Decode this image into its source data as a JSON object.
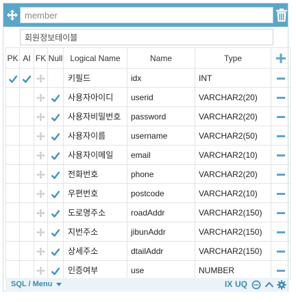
{
  "table_editor": {
    "table_name": "member",
    "table_comment": "회원정보테이블",
    "headers": {
      "pk": "PK",
      "ai": "AI",
      "fk": "FK",
      "null": "Null",
      "logical": "Logical Name",
      "name": "Name",
      "type": "Type"
    },
    "columns": [
      {
        "logical": "키필드",
        "name": "idx",
        "type": "INT",
        "pk": true,
        "ai": true,
        "null": false
      },
      {
        "logical": "사용자아이디",
        "name": "userid",
        "type": "VARCHAR2(20)",
        "pk": false,
        "ai": false,
        "null": true
      },
      {
        "logical": "사용자비밀번호",
        "name": "password",
        "type": "VARCHAR2(20)",
        "pk": false,
        "ai": false,
        "null": true
      },
      {
        "logical": "사용자이름",
        "name": "username",
        "type": "VARCHAR2(50)",
        "pk": false,
        "ai": false,
        "null": true
      },
      {
        "logical": "사용자이메일",
        "name": "email",
        "type": "VARCHAR2(10)",
        "pk": false,
        "ai": false,
        "null": true
      },
      {
        "logical": "전화번호",
        "name": "phone",
        "type": "VARCHAR2(20)",
        "pk": false,
        "ai": false,
        "null": true
      },
      {
        "logical": "우편번호",
        "name": "postcode",
        "type": "VARCHAR2(10)",
        "pk": false,
        "ai": false,
        "null": true
      },
      {
        "logical": "도로명주소",
        "name": "roadAddr",
        "type": "VARCHAR2(150)",
        "pk": false,
        "ai": false,
        "null": true
      },
      {
        "logical": "지번주소",
        "name": "jibunAddr",
        "type": "VARCHAR2(150)",
        "pk": false,
        "ai": false,
        "null": true
      },
      {
        "logical": "상세주소",
        "name": "dtailAddr",
        "type": "VARCHAR2(150)",
        "pk": false,
        "ai": false,
        "null": true
      },
      {
        "logical": "인증여부",
        "name": "use",
        "type": "NUMBER",
        "pk": false,
        "ai": false,
        "null": true
      }
    ],
    "footer": {
      "sql_menu": "SQL / Menu",
      "ix": "IX",
      "uq": "UQ"
    },
    "colors": {
      "accent": "#5aa6c8",
      "footer_text": "#3a89b3"
    },
    "icons": {
      "move": "move-arrows-icon",
      "trash": "trash-icon",
      "add": "plus-icon",
      "remove": "minus-icon",
      "check": "check-icon",
      "comment": "comment-icon",
      "collapse": "chevron-up-icon",
      "settings": "gear-icon"
    }
  }
}
